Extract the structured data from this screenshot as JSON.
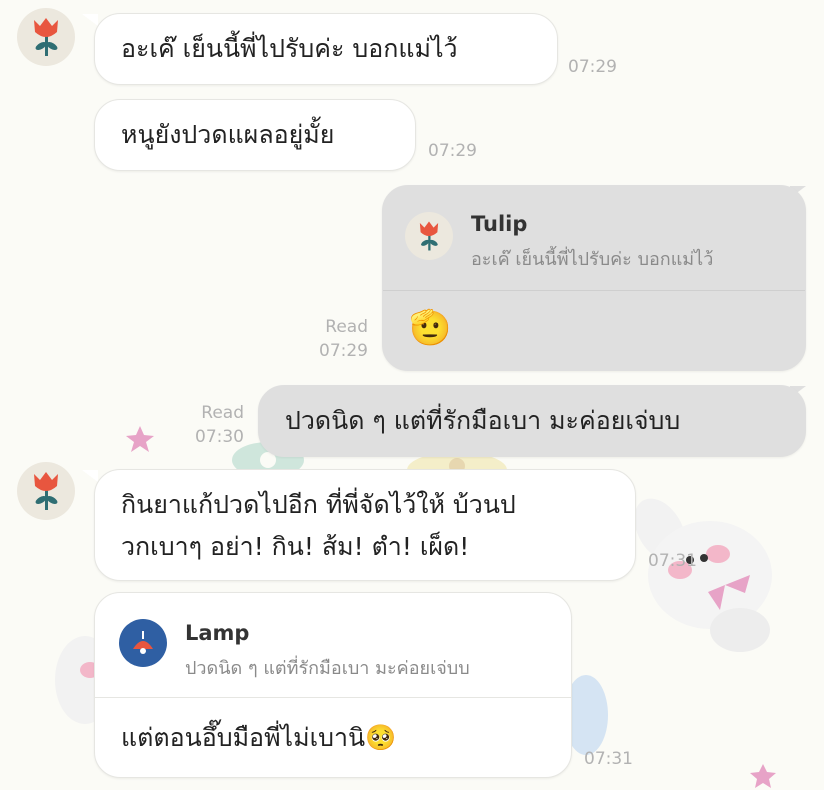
{
  "messages": [
    {
      "text": "อะเค๊ เย็นนี้พี่ไปรับค่ะ บอกแม่ไว้",
      "time": "07:29"
    },
    {
      "text": "หนูยังปวดแผลอยู่มั้ย",
      "time": "07:29"
    },
    {
      "reply_to": {
        "name": "Tulip",
        "quote": "อะเค๊ เย็นนี้พี่ไปรับค่ะ บอกแม่ไว้"
      },
      "text": "🫡",
      "status": "Read",
      "time": "07:29"
    },
    {
      "text": "ปวดนิด ๆ  แต่ที่รักมือเบา มะค่อยเจ่บบ",
      "status": "Read",
      "time": "07:30"
    },
    {
      "text_line1": "กินยาแก้ปวดไปอีก ที่พี่จัดไว้ให้ บ้วนป",
      "text_line2": "วกเบาๆ อย่า! กิน! ส้ม! ตำ! เผ็ด!",
      "time": "07:31"
    },
    {
      "reply_to": {
        "name": "Lamp",
        "quote": "ปวดนิด ๆ แต่ที่รักมือเบา มะค่อยเจ่บบ"
      },
      "text": "แต่ตอนอึ๊บมือพี่ไม่เบานิ🥺",
      "time": "07:31"
    }
  ],
  "avatars": {
    "friend": "tulip-icon",
    "me": "lamp-icon"
  },
  "colors": {
    "background": "#fbfbf6",
    "bubble_in": "#ffffff",
    "bubble_out": "#dfdfdf",
    "tulip_red": "#e8563f",
    "tulip_stem": "#2f6e73",
    "lamp_bg": "#2f5fa3"
  }
}
